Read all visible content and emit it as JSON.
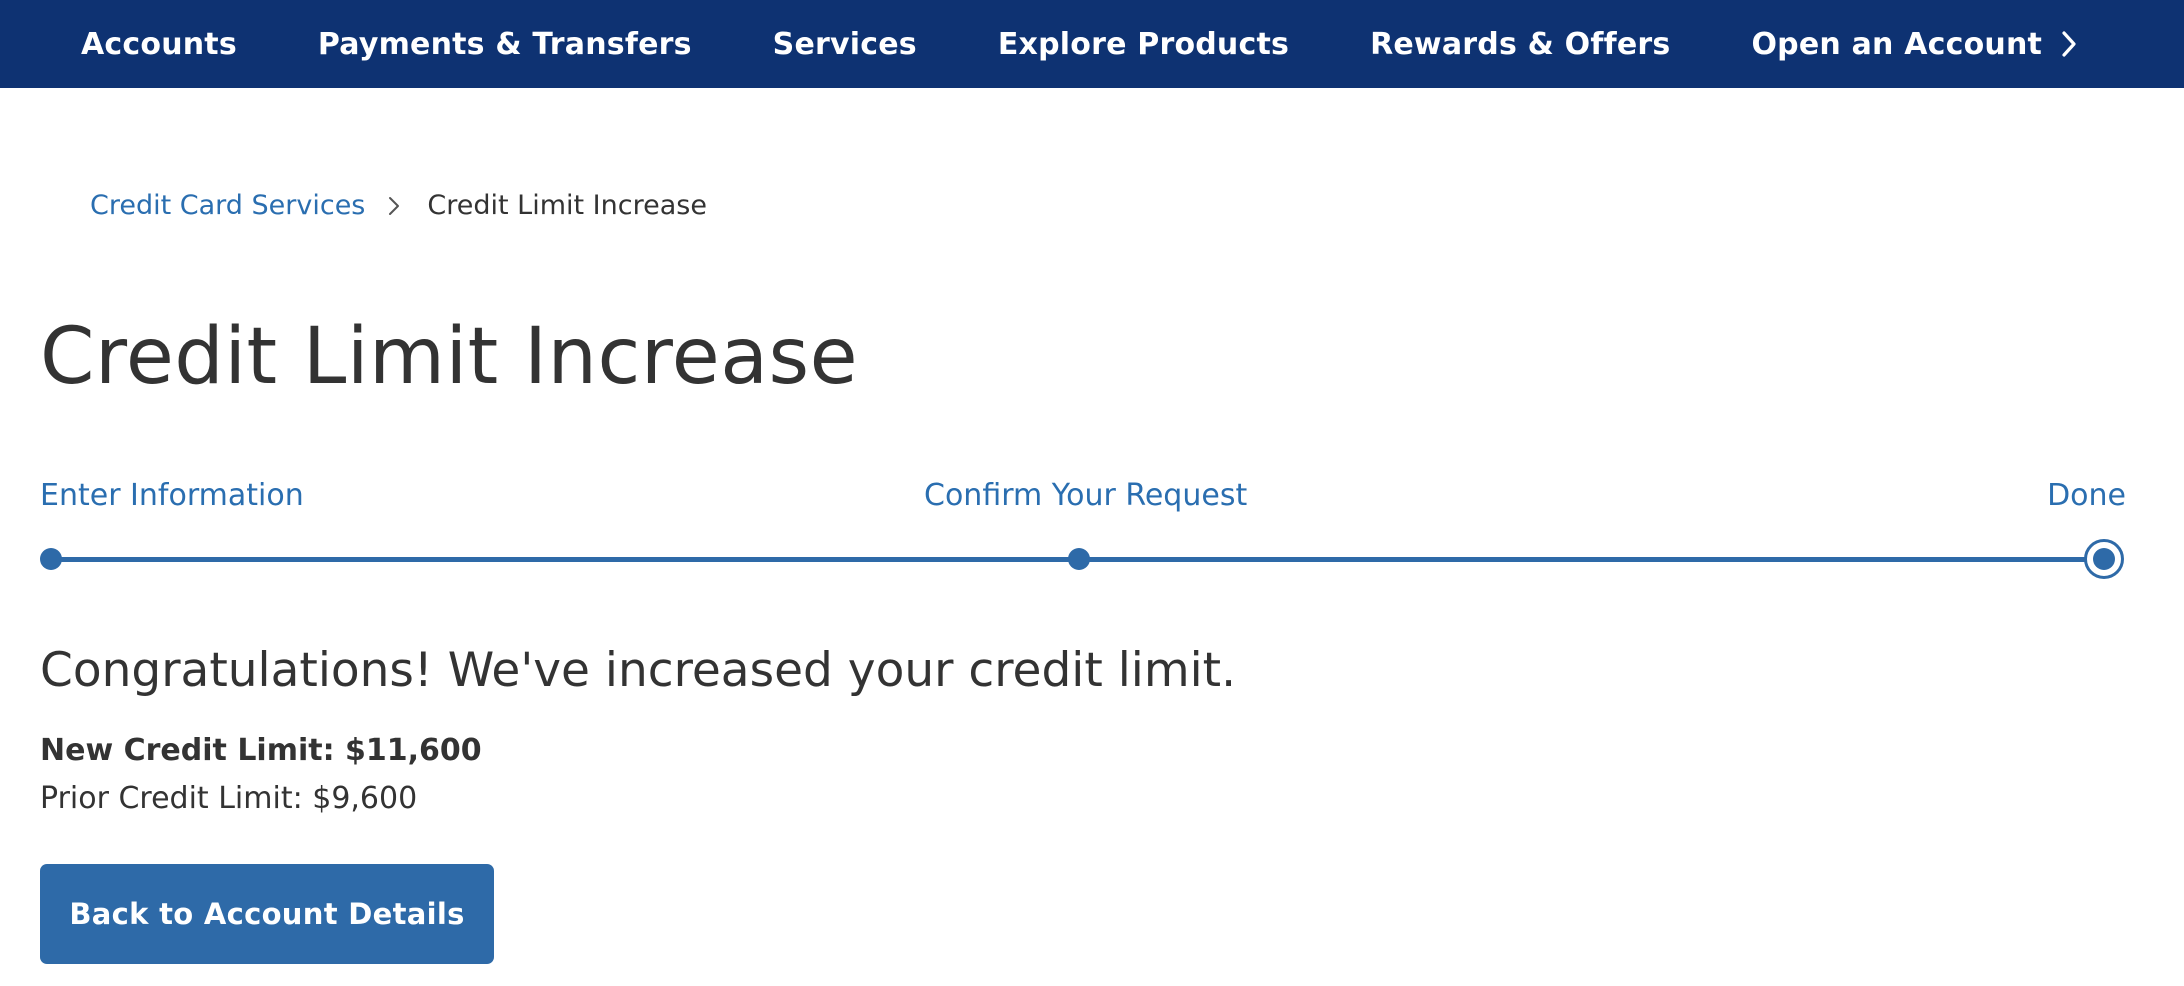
{
  "nav": {
    "items": [
      {
        "label": "Accounts"
      },
      {
        "label": "Payments & Transfers"
      },
      {
        "label": "Services"
      },
      {
        "label": "Explore Products"
      },
      {
        "label": "Rewards & Offers"
      },
      {
        "label": "Open an Account",
        "icon": "chevron-right-icon"
      }
    ]
  },
  "breadcrumb": {
    "parent": "Credit Card Services",
    "separator_icon": "chevron-right-icon",
    "current": "Credit Limit Increase"
  },
  "page": {
    "title": "Credit Limit Increase"
  },
  "stepper": {
    "steps": [
      {
        "label": "Enter Information",
        "state": "complete"
      },
      {
        "label": "Confirm Your Request",
        "state": "complete"
      },
      {
        "label": "Done",
        "state": "current"
      }
    ]
  },
  "result": {
    "heading": "Congratulations! We've increased your credit limit.",
    "new_limit": "New Credit Limit: $11,600",
    "prior_limit": "Prior Credit Limit: $9,600"
  },
  "actions": {
    "back_label": "Back to Account Details"
  },
  "colors": {
    "nav_background": "#0e3272",
    "accent": "#2e6aa8",
    "link": "#2a6eb0",
    "text": "#333333"
  }
}
